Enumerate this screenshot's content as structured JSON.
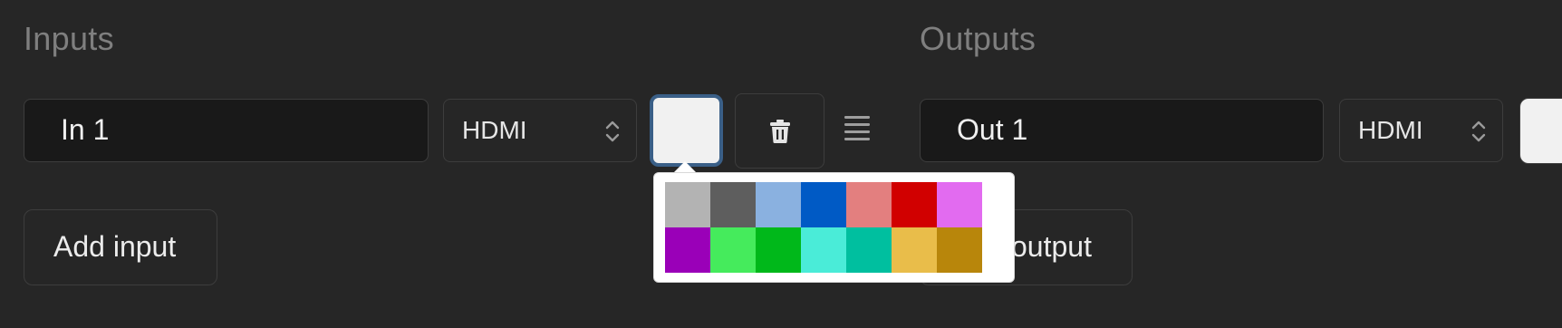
{
  "inputs": {
    "title": "Inputs",
    "rows": [
      {
        "name": "In 1",
        "type": "HDMI",
        "color": "#f1f1f1"
      }
    ],
    "add_label": "Add input"
  },
  "outputs": {
    "title": "Outputs",
    "rows": [
      {
        "name": "Out 1",
        "type": "HDMI",
        "color": "#f1f1f1"
      }
    ],
    "add_label_visible": "output"
  },
  "icons": {
    "delete": "trash-icon",
    "drag": "drag-handle-icon",
    "select": "chevron-up-down-icon"
  },
  "color_picker": {
    "swatches": [
      "#b3b3b3",
      "#5e5e5e",
      "#8ab1e0",
      "#005ac5",
      "#e37f7f",
      "#d10000",
      "#e26bf0",
      "#9a00b8",
      "#45eb5c",
      "#00b81a",
      "#4aecd8",
      "#00bf9f",
      "#e9bd4a",
      "#b8860b"
    ]
  }
}
